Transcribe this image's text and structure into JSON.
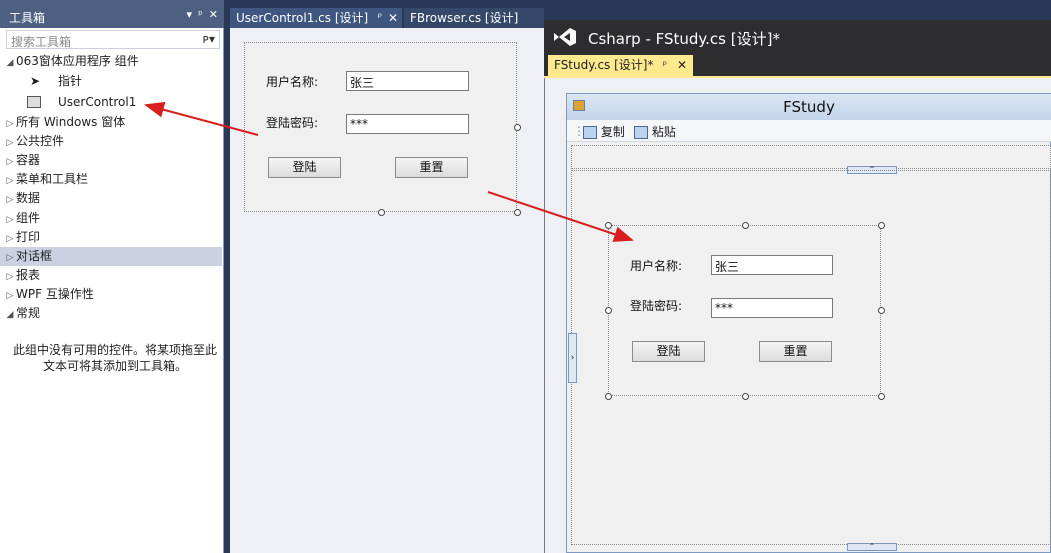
{
  "toolbox": {
    "title": "工具箱",
    "controls": [
      "▾",
      "ᵖ",
      "✕"
    ],
    "search_placeholder": "搜索工具箱",
    "search_icon": "ᴘ▾",
    "group_expanded": "063窗体应用程序 组件",
    "items": [
      {
        "label": "指针",
        "icon": "pointer-icon"
      },
      {
        "label": "UserControl1",
        "icon": "usercontrol-icon"
      }
    ],
    "groups": [
      "所有 Windows 窗体",
      "公共控件",
      "容器",
      "菜单和工具栏",
      "数据",
      "组件",
      "打印",
      "对话框",
      "报表",
      "WPF 互操作性",
      "常规"
    ],
    "selected_group": "对话框",
    "empty_note": "此组中没有可用的控件。将某项拖至此文本可将其添加到工具箱。"
  },
  "tabs": [
    {
      "label": "UserControl1.cs [设计]",
      "pin": "ᵖ",
      "close": "✕"
    },
    {
      "label": "FBrowser.cs [设计]"
    }
  ],
  "usercontrol": {
    "username_label": "用户名称:",
    "username_value": "张三",
    "password_label": "登陆密码:",
    "password_value": "***",
    "login_button": "登陆",
    "reset_button": "重置"
  },
  "vs_window": {
    "caption": "Csharp - FStudy.cs [设计]*",
    "tab_label": "FStudy.cs [设计]*",
    "tab_pin": "ᵖ",
    "tab_close": "✕"
  },
  "form": {
    "title": "FStudy",
    "menu": [
      {
        "label": "复制",
        "icon": "picture-icon"
      },
      {
        "label": "粘贴",
        "icon": "picture-icon"
      }
    ],
    "username_label": "用户名称:",
    "username_value": "张三",
    "password_label": "登陆密码:",
    "password_value": "***",
    "login_button": "登陆",
    "reset_button": "重置"
  },
  "colors": {
    "background": "#293955",
    "toolbox_header": "#4d6082",
    "active_tab": "#ffe98f",
    "arrow": "#d81e1e"
  }
}
